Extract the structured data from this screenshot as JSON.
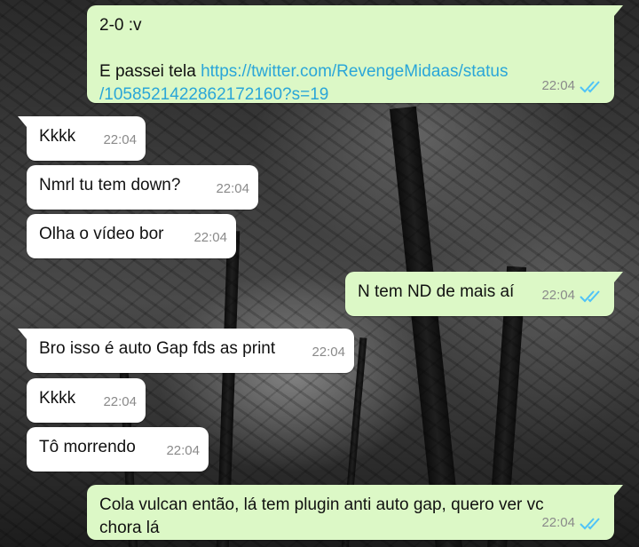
{
  "messages": [
    {
      "direction": "out",
      "line1": "2-0 :v",
      "line2_prefix": "E passei tela ",
      "link": "https://twitter.com/RevengeMidaas/status/1058521422862172160?s=19",
      "link_part1": "https://twitter.com/RevengeMidaas/status",
      "link_part2": "/1058521422862172160?s=19",
      "time": "22:04",
      "status": "read"
    },
    {
      "direction": "in",
      "text": "Kkkk",
      "time": "22:04"
    },
    {
      "direction": "in",
      "text": "Nmrl tu tem down?",
      "time": "22:04"
    },
    {
      "direction": "in",
      "text": "Olha o vídeo bor",
      "time": "22:04"
    },
    {
      "direction": "out",
      "text": "N tem ND de mais aí",
      "time": "22:04",
      "status": "read"
    },
    {
      "direction": "in",
      "text": "Bro isso é auto Gap fds as print",
      "time": "22:04"
    },
    {
      "direction": "in",
      "text": "Kkkk",
      "time": "22:04"
    },
    {
      "direction": "in",
      "text": "Tô morrendo",
      "time": "22:04"
    },
    {
      "direction": "out",
      "line1": "Cola vulcan então, lá tem plugin anti auto gap, quero ver vc",
      "line2": "chora lá",
      "time": "22:04",
      "status": "read"
    }
  ],
  "colors": {
    "outgoing_bubble": "#dcf8c6",
    "incoming_bubble": "#ffffff",
    "link": "#2aa6d8",
    "read_ticks": "#4fc3f7",
    "timestamp": "#8a8a8a"
  },
  "icons": {
    "read_receipt": "double-check-icon"
  }
}
